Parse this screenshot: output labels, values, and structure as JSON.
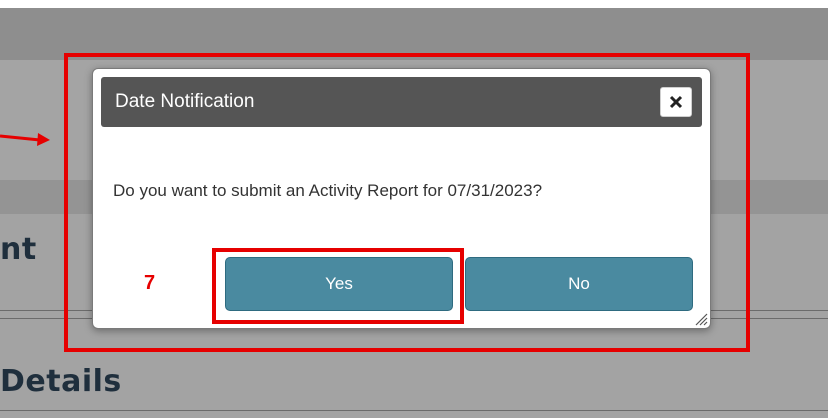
{
  "background": {
    "heading_1_fragment": "nt",
    "heading_2_fragment": "Details"
  },
  "dialog": {
    "title": "Date Notification",
    "close_icon": "close-x-icon",
    "message": "Do you want to submit an Activity Report for 07/31/2023?",
    "yes_label": "Yes",
    "no_label": "No",
    "button_color": "#4a8aa0",
    "header_color": "#555555"
  },
  "annotation": {
    "step_number": "7",
    "highlight_color": "#e60000"
  }
}
